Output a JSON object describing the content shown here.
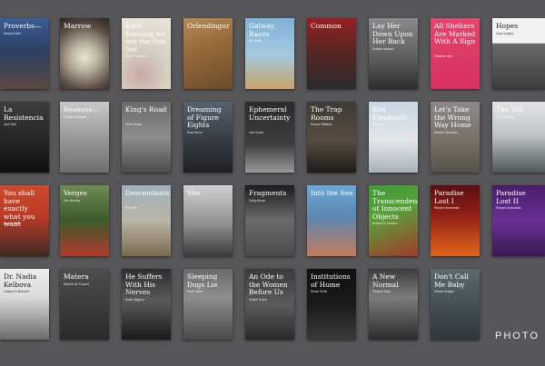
{
  "brand": {
    "logo_text": "PHOTO"
  },
  "covers": [
    {
      "title": "Proverbs—",
      "author": "Dwayne Allen",
      "bg": "linear-gradient(180deg,#3c5e93 0%,#2b3f66 45%,#5a4a3e 100%)"
    },
    {
      "title": "Marrow",
      "author": "",
      "bg": "radial-gradient(circle at 50% 55%,#e9e3d4 0%,#b9b1a0 30%,#5b4d44 70%,#2c2422 100%)"
    },
    {
      "title": "Each Evening we see the Sun Set",
      "author": "Bowie Rowlands",
      "bg": "radial-gradient(circle at 40% 80%,#c9a9a2 0%,#d6cfc3 40%,#eae5da 100%)",
      "dark": false
    },
    {
      "title": "Orlendingur",
      "author": "",
      "bg": "linear-gradient(160deg,#b48b54 0%,#94693a 45%,#6b4b2a 100%)"
    },
    {
      "title": "Galway Races",
      "author": "Joe Smith",
      "bg": "linear-gradient(180deg,#7fb1d6 0%,#a3c9e2 50%,#c9a46a 100%)"
    },
    {
      "title": "Common",
      "author": "",
      "bg": "linear-gradient(180deg,#9a1f22 0%,#5e2522 40%,#2b2a2c 100%)"
    },
    {
      "title": "Lay Her Down Upon Her Back",
      "author": "Andrew Jackson",
      "bg": "linear-gradient(180deg,#8a8a8a 0%,#5a5a5a 60%,#2e2e2e 100%)"
    },
    {
      "title": "All Shelters Are Marked With A Sign",
      "author": "Charlotte Hart",
      "bg": "linear-gradient(180deg,#e4466d 0%,#d63160 100%)"
    },
    {
      "title": "Hopes",
      "author": "Hugh Quigley",
      "bg": "linear-gradient(180deg,#f2f2f2 0%,#f2f2f2 35%,#6a6a6a 36%,#3c3c3c 100%)",
      "dark": true
    },
    {
      "title": "La Resistencia",
      "author": "Jack Wall",
      "bg": "linear-gradient(180deg,#3d3d3d 0%,#222 60%,#0f0f0f 100%)"
    },
    {
      "title": "Reasons—",
      "author": "Colman Grimwald",
      "bg": "linear-gradient(180deg,#c8c8c8 0%,#9a9a9a 50%,#6e6e6e 100%)"
    },
    {
      "title": "King's Road",
      "author": "Kevin Schaw",
      "bg": "linear-gradient(180deg,#6b6b6b 0%,#8d8d8d 50%,#4b4b4b 100%)"
    },
    {
      "title": "Dreaming of Figure Eights",
      "author": "Sean Bresn",
      "bg": "linear-gradient(180deg,#56626e 0%,#34393f 60%,#1e2023 100%)"
    },
    {
      "title": "Ephemeral Uncertainty",
      "author": "Jord Kerwe",
      "bg": "linear-gradient(180deg,#2b2b2b 0%,#3d3d3d 60%,#9a9a9a 100%)"
    },
    {
      "title": "The Trap Rooms",
      "author": "Simone Williams",
      "bg": "linear-gradient(180deg,#3f3a34 0%,#574c40 55%,#1f1c19 100%)"
    },
    {
      "title": "Red Elephants",
      "author": "Tiri Hugh",
      "bg": "linear-gradient(180deg,#c7d7e4 0%,#e3e6e8 55%,#a7b2b8 100%)"
    },
    {
      "title": "Let's Take the Wrong Way Home",
      "author": "Andrew Kimberton",
      "bg": "linear-gradient(180deg,#8a8a8a 0%,#7a7066 55%,#55504a 100%)"
    },
    {
      "title": "The Hill",
      "author": "Ruth Vaughan",
      "bg": "linear-gradient(180deg,#e2e4e4 0%,#c0c7c6 45%,#4f5857 100%)"
    },
    {
      "title": "You shall have exactly what you want",
      "author": "Sarah Collins",
      "bg": "linear-gradient(180deg,#cf4a2c 0%,#b83a27 45%,#3e2a22 100%)"
    },
    {
      "title": "Verges",
      "author": "Dan Mundey",
      "bg": "linear-gradient(180deg,#6e8b53 0%,#3d5a2b 50%,#b23a2a 100%)"
    },
    {
      "title": "Descendants",
      "author": "Ed Smith",
      "bg": "linear-gradient(180deg,#9eb0bf 0%,#b9b4a6 50%,#7a6a4e 100%)"
    },
    {
      "title": "She",
      "author": "",
      "bg": "linear-gradient(180deg,#d0d0d0 0%,#8f8f8f 55%,#3b3b3b 100%)"
    },
    {
      "title": "Fragments",
      "author": "Cathy Brown",
      "bg": "linear-gradient(180deg,#1c1c1c 0%,#6b6b6b 50%,#4a4a4a 100%)"
    },
    {
      "title": "Into the Sea",
      "author": "",
      "bg": "linear-gradient(180deg,#6aa9d6 0%,#5c88b0 45%,#c47a5a 100%)"
    },
    {
      "title": "The Transcendence of Innocent Objects",
      "author": "Samuel M. Dawson",
      "bg": "linear-gradient(160deg,#3f9a38 0%,#5aa03a 40%,#a23a2a 100%)"
    },
    {
      "title": "Paradise Lost I",
      "author": "Richard Greenwald",
      "bg": "linear-gradient(180deg,#5a0f10 0%,#8e1d16 40%,#e1641e 100%)"
    },
    {
      "title": "Paradise Lost II",
      "author": "Richard Greenwald",
      "bg": "linear-gradient(180deg,#4a1d6b 0%,#6a2f95 50%,#3a1a55 100%)"
    },
    {
      "title": "Dr. Nadia Kelbova",
      "author": "Justyna Kurlhanová",
      "bg": "linear-gradient(180deg,#ececec 0%,#dadada 40%,#6a6a6a 100%)",
      "dark": true
    },
    {
      "title": "Matera",
      "author": "Maurice de Courcer",
      "bg": "linear-gradient(180deg,#4e4e4e 0%,#2a2a2a 100%)"
    },
    {
      "title": "He Suffers With His Nerves",
      "author": "Helen Maguire",
      "bg": "linear-gradient(180deg,#2d2d2d 0%,#5a5a5a 45%,#1a1a1a 100%)"
    },
    {
      "title": "Sleeping Dogs Lie",
      "author": "Anne Haaba",
      "bg": "linear-gradient(180deg,#6a6a6a 0%,#8d8d8d 40%,#4a4a4a 100%)"
    },
    {
      "title": "An Ode to the Women Before Us",
      "author": "Sophie Roche",
      "bg": "linear-gradient(180deg,#3a3a3a 0%,#5b5b5b 50%,#2a2a2a 100%)"
    },
    {
      "title": "Institutions of Home",
      "author": "Niamh Smith",
      "bg": "linear-gradient(180deg,#101010 0%,#1a1a1a 50%,#3a3a3a 100%)"
    },
    {
      "title": "A New Normal",
      "author": "Stephen Kelly",
      "bg": "linear-gradient(180deg,#3d3d3d 0%,#7b7b7b 40%,#2c2c2c 100%)"
    },
    {
      "title": "Don't Call Me Baby",
      "author": "Sinead Keegan",
      "bg": "linear-gradient(180deg,#5a6a70 0%,#2f3639 100%)"
    }
  ]
}
